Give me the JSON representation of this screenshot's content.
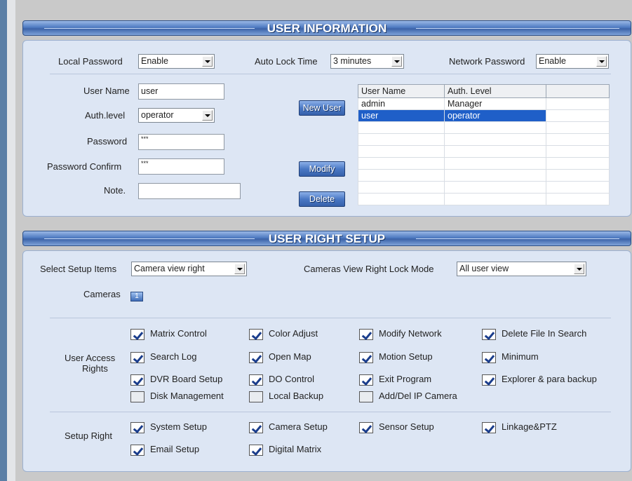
{
  "user_info": {
    "title": "USER INFORMATION",
    "local_password": {
      "label": "Local Password",
      "value": "Enable"
    },
    "auto_lock": {
      "label": "Auto Lock Time",
      "value": "3 minutes"
    },
    "network_password": {
      "label": "Network Password",
      "value": "Enable"
    },
    "form": {
      "user_name": {
        "label": "User Name",
        "value": "user"
      },
      "auth_level": {
        "label": "Auth.level",
        "value": "operator"
      },
      "password": {
        "label": "Password",
        "value": "***"
      },
      "password_confirm": {
        "label": "Password Confirm",
        "value": "***"
      },
      "note": {
        "label": "Note.",
        "value": ""
      }
    },
    "buttons": {
      "new_user": "New User",
      "modify": "Modify",
      "delete": "Delete"
    },
    "table": {
      "headers": [
        "User Name",
        "Auth. Level",
        ""
      ],
      "rows": [
        {
          "name": "admin",
          "level": "Manager",
          "selected": false
        },
        {
          "name": "user",
          "level": "operator",
          "selected": true
        }
      ]
    }
  },
  "user_right": {
    "title": "USER RIGHT SETUP",
    "select_setup": {
      "label": "Select Setup Items",
      "value": "Camera view right"
    },
    "lock_mode": {
      "label": "Cameras View Right Lock Mode",
      "value": "All user view"
    },
    "cameras": {
      "label": "Cameras",
      "button": "1"
    },
    "access_label_line1": "User Access",
    "access_label_line2": "Rights",
    "access_rights": [
      {
        "label": "Matrix Control",
        "checked": true
      },
      {
        "label": "Color Adjust",
        "checked": true
      },
      {
        "label": "Modify Network",
        "checked": true
      },
      {
        "label": "Delete File In Search",
        "checked": true
      },
      {
        "label": "Search Log",
        "checked": true
      },
      {
        "label": "Open Map",
        "checked": true
      },
      {
        "label": "Motion Setup",
        "checked": true
      },
      {
        "label": "Minimum",
        "checked": true
      },
      {
        "label": "DVR Board Setup",
        "checked": true
      },
      {
        "label": "DO Control",
        "checked": true
      },
      {
        "label": "Exit Program",
        "checked": true
      },
      {
        "label": "Explorer & para backup",
        "checked": true
      },
      {
        "label": "Disk Management",
        "checked": false
      },
      {
        "label": "Local Backup",
        "checked": false
      },
      {
        "label": "Add/Del IP Camera",
        "checked": false
      }
    ],
    "setup_label": "Setup Right",
    "setup_rights": [
      {
        "label": "System Setup",
        "checked": true
      },
      {
        "label": "Camera Setup",
        "checked": true
      },
      {
        "label": "Sensor Setup",
        "checked": true
      },
      {
        "label": "Linkage&PTZ",
        "checked": true
      },
      {
        "label": "Email Setup",
        "checked": true
      },
      {
        "label": "Digital Matrix",
        "checked": true
      }
    ]
  }
}
